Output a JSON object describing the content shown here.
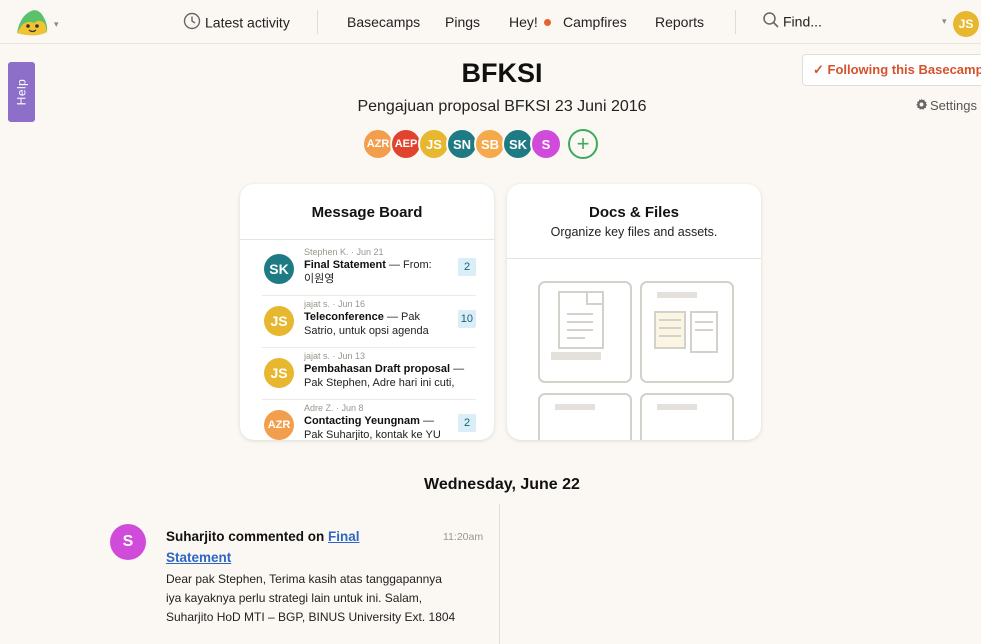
{
  "nav": {
    "latest_activity": "Latest activity",
    "basecamps": "Basecamps",
    "pings": "Pings",
    "hey": "Hey!",
    "campfires": "Campfires",
    "reports": "Reports",
    "find": "Find...",
    "me_initials": "JS"
  },
  "help": "Help",
  "project": {
    "title": "BFKSI",
    "subtitle": "Pengajuan proposal BFKSI 23 Juni 2016",
    "follow_label": "✓ Following this Basecamp",
    "settings_label": "Settings"
  },
  "people": [
    {
      "initials": "AZR",
      "color": "#f39e4d"
    },
    {
      "initials": "AEP",
      "color": "#e1432f"
    },
    {
      "initials": "JS",
      "color": "#e8b730"
    },
    {
      "initials": "SN",
      "color": "#1f7b83"
    },
    {
      "initials": "SB",
      "color": "#f5a94b"
    },
    {
      "initials": "SK",
      "color": "#1f7b83"
    },
    {
      "initials": "S",
      "color": "#d14bdb"
    }
  ],
  "message_board": {
    "title": "Message Board",
    "messages": [
      {
        "initials": "SK",
        "color": "#1f7b83",
        "meta": "Stephen K. · Jun 21",
        "subject": "Final Statement",
        "excerpt": " — From: 이원영",
        "count": "2"
      },
      {
        "initials": "JS",
        "color": "#e8b730",
        "meta": "jajat s. · Jun 16",
        "subject": "Teleconference",
        "excerpt": " — Pak Satrio, untuk opsi agenda",
        "count": "10"
      },
      {
        "initials": "JS",
        "color": "#e8b730",
        "meta": "jajat s. · Jun 13",
        "subject": "Pembahasan Draft proposal",
        "excerpt": " — Pak Stephen, Adre hari ini cuti,",
        "count": ""
      },
      {
        "initials": "AZR",
        "color": "#f39e4d",
        "meta": "Adre Z. · Jun 8",
        "subject": "Contacting Yeungnam",
        "excerpt": " — Pak Suharjito, kontak ke YU",
        "count": "2"
      }
    ]
  },
  "docs_files": {
    "title": "Docs & Files",
    "subtitle": "Organize key files and assets."
  },
  "activity": {
    "day": "Wednesday, June 22",
    "avatar_initials": "S",
    "actor_text": "Suharjito commented on ",
    "target": "Final Statement",
    "time": "11:20am",
    "body": "Dear pak Stephen, Terima kasih atas tanggapannya iya kayaknya perlu strategi lain untuk ini. Salam, Suharjito HoD MTI – BGP, BINUS University Ext. 1804"
  },
  "colors": {
    "background": "#fbf8f3",
    "help_tab": "#8d6fc9",
    "follow": "#d5532b",
    "link": "#2e66c4"
  }
}
